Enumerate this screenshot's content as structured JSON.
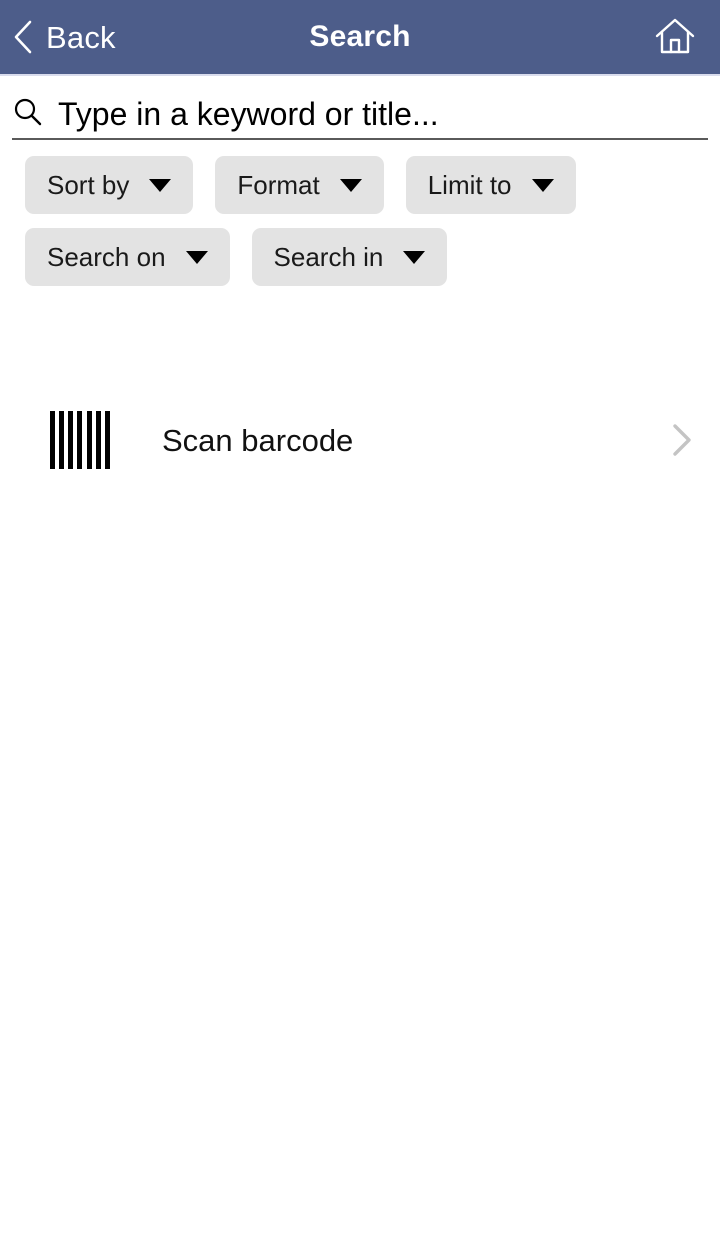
{
  "header": {
    "back_label": "Back",
    "title": "Search",
    "back_icon": "chevron-left-icon",
    "home_icon": "home-icon",
    "background_color": "#4d5d8a",
    "text_color": "#ffffff"
  },
  "search": {
    "icon": "search-icon",
    "value": "",
    "placeholder": "Type in a keyword or title..."
  },
  "filters": {
    "caret_icon": "chevron-down-icon",
    "chip_color": "#e3e3e3",
    "rows": [
      [
        {
          "label": "Sort by",
          "name": "sort-by"
        },
        {
          "label": "Format",
          "name": "format"
        },
        {
          "label": "Limit to",
          "name": "limit-to"
        }
      ],
      [
        {
          "label": "Search on",
          "name": "search-on"
        },
        {
          "label": "Search in",
          "name": "search-in"
        }
      ]
    ]
  },
  "scan": {
    "label": "Scan barcode",
    "icon": "barcode-icon",
    "chevron_icon": "chevron-right-icon",
    "chevron_color": "#c4c4c4",
    "bar_count": 7
  }
}
